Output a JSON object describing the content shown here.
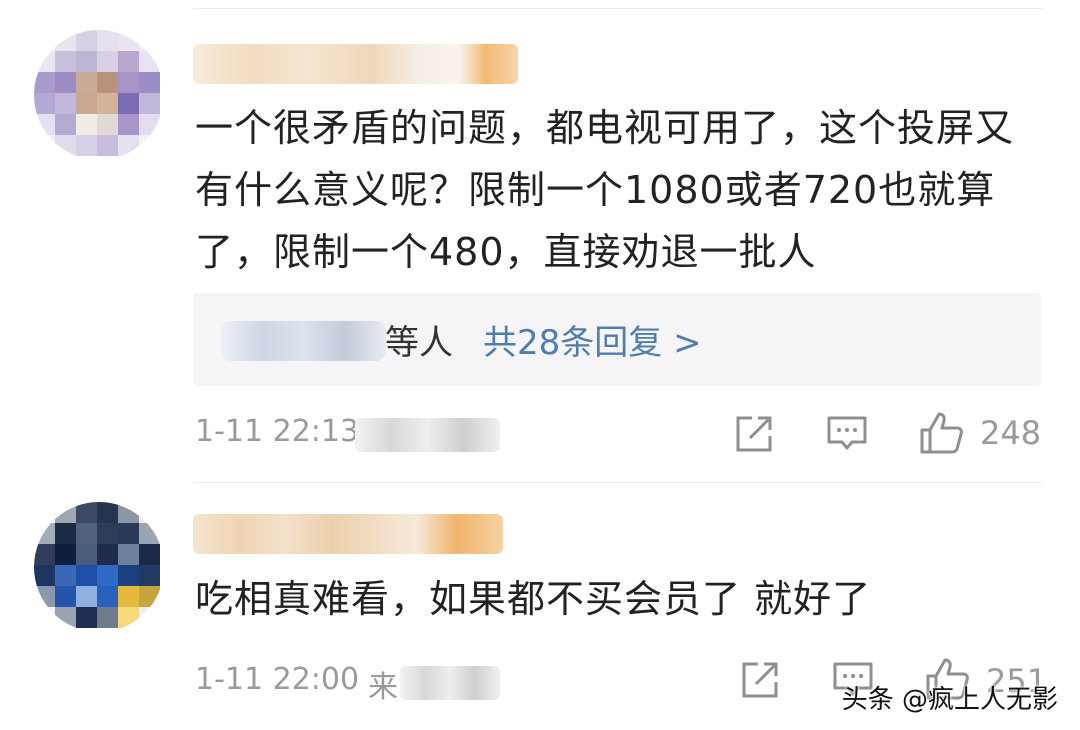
{
  "comments": [
    {
      "text": "一个很矛盾的问题，都电视可用了，这个投屏又有什么意义呢？限制一个1080或者720也就算了，限制一个480，直接劝退一批人",
      "reply_suffix": "等人",
      "reply_count_text": "共28条回复 >",
      "timestamp": "1-11 22:13",
      "like_count": "248",
      "icons": [
        "share-icon",
        "comment-icon",
        "thumbs-up-icon"
      ]
    },
    {
      "text": "吃相真难看，如果都不买会员了 就好了",
      "timestamp": "1-11 22:00",
      "source_prefix": "来",
      "like_count": "251",
      "icons": [
        "share-icon",
        "comment-icon",
        "thumbs-up-icon"
      ]
    }
  ],
  "watermark": "头条 @疯上人无影",
  "colors": {
    "link": "#507daf",
    "meta": "#9a9a9a",
    "text": "#222222"
  }
}
